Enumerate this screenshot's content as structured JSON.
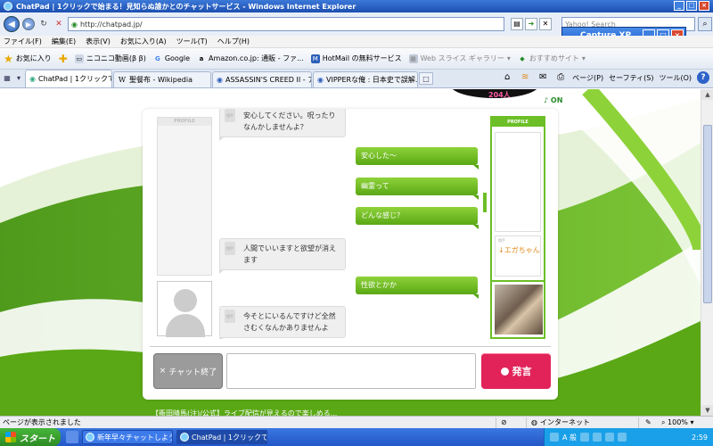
{
  "window": {
    "title": "ChatPad | 1クリックで始まる！見知らぬ誰かとのチャットサービス - Windows Internet Explorer"
  },
  "capture_overlay": {
    "title": "Capture XP"
  },
  "addressbar": {
    "url": "http://chatpad.jp/",
    "search_placeholder": "Yahoo! Search"
  },
  "menu": [
    "ファイル(F)",
    "編集(E)",
    "表示(V)",
    "お気に入り(A)",
    "ツール(T)",
    "ヘルプ(H)"
  ],
  "favorites": {
    "label": "お気に入り",
    "items": [
      "ニコニコ動画(β β)",
      "Google",
      "Amazon.co.jp: 通販 - ファ...",
      "HotMail の無料サービス",
      "Web スライス ギャラリー",
      "おすすめサイト"
    ]
  },
  "tabs": [
    {
      "label": "ChatPad | 1クリックで始ま...",
      "active": true
    },
    {
      "label": "聖餐布 - Wikipedia",
      "active": false
    },
    {
      "label": "ASSASSIN'S CREED II - ア...",
      "active": false
    },
    {
      "label": "VIPPERな俺 : 日本史で誤解...",
      "active": false
    }
  ],
  "toolbar": {
    "page": "ページ(P)",
    "safety": "セーフティ(S)",
    "tools": "ツール(O)"
  },
  "page": {
    "online_count": "204人",
    "on_label": "ON",
    "profile_header": "PROFILE",
    "partner_label": "相手",
    "partner_name": "↓エガちゃん",
    "footer_text": "【衝田晴馬(注)/公式】ライブ配信が見えるので楽しめる..."
  },
  "messages": [
    {
      "side": "left",
      "tag": "相手",
      "text": "安心してください。呪ったりなんかしませんよ？"
    },
    {
      "side": "right",
      "text": "安心した～"
    },
    {
      "side": "right",
      "text": "幽霊って"
    },
    {
      "side": "right",
      "text": "どんな感じ？"
    },
    {
      "side": "left",
      "tag": "相手",
      "text": "人間でいいますと欲望が消えます"
    },
    {
      "side": "right",
      "text": "性欲とかか"
    },
    {
      "side": "left",
      "tag": "相手",
      "text": "今そとにいるんですけど全然さむくなんかありませんよ"
    }
  ],
  "controls": {
    "end_chat": "チャット終了",
    "send": "発言"
  },
  "statusbar": {
    "text": "ページが表示されました",
    "zone": "インターネット",
    "zoom": "100%"
  },
  "taskbar": {
    "start": "スタート",
    "buttons": [
      "新年早々チャットしよう...",
      "ChatPad | 1クリックで..."
    ],
    "tray_lang": "A 般",
    "clock": "2:59"
  },
  "colors": {
    "accent_green": "#6cbf26",
    "send_pink": "#e1235a",
    "titlebar_blue": "#1c4fb0"
  }
}
